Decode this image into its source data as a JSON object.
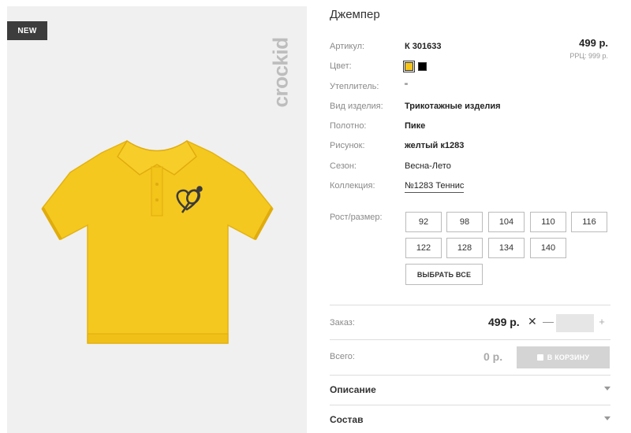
{
  "badge": {
    "new": "NEW"
  },
  "brand": {
    "logo_text": "crockid"
  },
  "product": {
    "title": "Джемпер",
    "price": "499 р.",
    "rrp": "РРЦ: 999 р.",
    "attributes": [
      {
        "label": "Артикул:",
        "value": "К 301633"
      },
      {
        "label": "Цвет:",
        "value": ""
      },
      {
        "label": "Утеплитель:",
        "value": "\""
      },
      {
        "label": "Вид изделия:",
        "value": "Трикотажные изделия"
      },
      {
        "label": "Полотно:",
        "value": "Пике"
      },
      {
        "label": "Рисунок:",
        "value": "желтый к1283"
      },
      {
        "label": "Сезон:",
        "value": "Весна-Лето"
      },
      {
        "label": "Коллекция:",
        "value": "№1283 Теннис"
      }
    ],
    "colors": [
      "#f5c519",
      "#000000"
    ],
    "selected_color": "#f5c519"
  },
  "sizes": {
    "label": "Рост/размер:",
    "options": [
      "92",
      "98",
      "104",
      "110",
      "116",
      "122",
      "128",
      "134",
      "140"
    ],
    "select_all": "ВЫБРАТЬ ВСЕ"
  },
  "order": {
    "label": "Заказ:",
    "price": "499 р.",
    "times": "✕",
    "minus": "—",
    "plus": "+",
    "quantity": ""
  },
  "total": {
    "label": "Всего:",
    "value": "0 р.",
    "cart_button": "В КОРЗИНУ"
  },
  "sections": [
    {
      "label": "Описание"
    },
    {
      "label": "Состав"
    }
  ],
  "icons": {
    "cart": "cart-icon",
    "caret": "chevron-down-icon"
  }
}
